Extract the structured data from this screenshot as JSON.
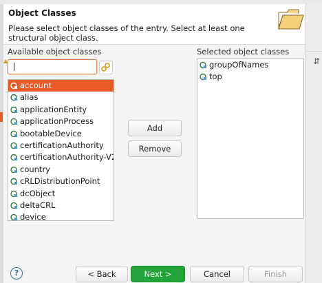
{
  "dialog": {
    "title": "Object Classes",
    "description": "Please select object classes of the entry. Select at least one structural object class."
  },
  "available": {
    "label": "Available object classes",
    "filter_value": "",
    "items": [
      "account",
      "alias",
      "applicationEntity",
      "applicationProcess",
      "bootableDevice",
      "certificationAuthority",
      "certificationAuthority-V2",
      "country",
      "cRLDistributionPoint",
      "dcObject",
      "deltaCRL",
      "device"
    ],
    "selected_item": "account"
  },
  "selected": {
    "label": "Selected object classes",
    "items": [
      "groupOfNames",
      "top"
    ]
  },
  "buttons": {
    "add": "Add",
    "remove": "Remove",
    "back": "< Back",
    "next": "Next >",
    "cancel": "Cancel",
    "finish": "Finish",
    "help": "?"
  },
  "icons": {
    "banner": "folder-icon",
    "clear": "clear-filter-icon",
    "object_class": "object-class-icon",
    "help": "help-icon"
  },
  "colors": {
    "selection": "#e65a28",
    "primary_button": "#23a43a",
    "input_focus": "#e8834f"
  }
}
